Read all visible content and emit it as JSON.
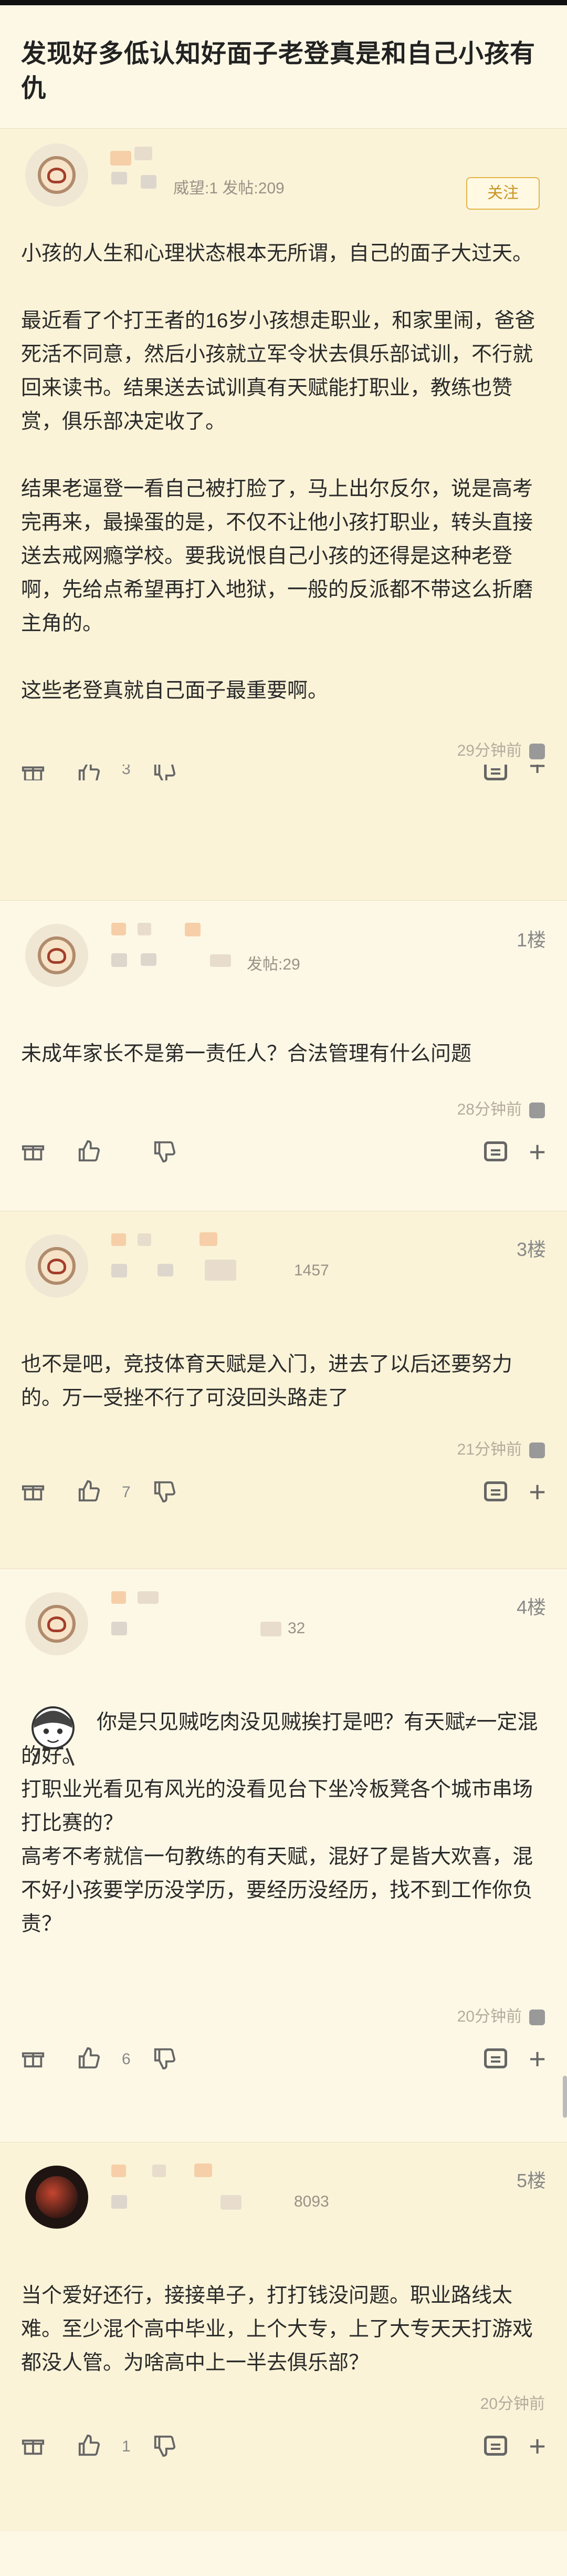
{
  "thread": {
    "title": "发现好多低认知好面子老登真是和自己小孩有仇"
  },
  "op": {
    "meta": "威望:1 发帖:209",
    "follow_label": "关注",
    "paragraphs": [
      "小孩的人生和心理状态根本无所谓，自己的面子大过天。",
      "最近看了个打王者的16岁小孩想走职业，和家里闹，爸爸死活不同意，然后小孩就立军令状去俱乐部试训，不行就回来读书。结果送去试训真有天赋能打职业，教练也赞赏，俱乐部决定收了。",
      "结果老逼登一看自己被打脸了，马上出尔反尔，说是高考完再来，最操蛋的是，不仅不让他小孩打职业，转头直接送去戒网瘾学校。要我说恨自己小孩的还得是这种老登啊，先给点希望再打入地狱，一般的反派都不带这么折磨主角的。",
      "这些老登真就自己面子最重要啊。"
    ],
    "time": "29分钟前",
    "like_count": "3"
  },
  "replies": [
    {
      "floor": "1楼",
      "meta": "发帖:29",
      "paragraphs": [
        "未成年家长不是第一责任人？合法管理有什么问题"
      ],
      "time": "28分钟前",
      "like_count": ""
    },
    {
      "floor": "3楼",
      "meta": "1457",
      "paragraphs": [
        "也不是吧，竞技体育天赋是入门，进去了以后还要努力的。万一受挫不行了可没回头路走了"
      ],
      "time": "21分钟前",
      "like_count": "7"
    },
    {
      "floor": "4楼",
      "meta": "32",
      "paragraphs": [
        "你是只见贼吃肉没见贼挨打是吧？有天赋≠一定混的好。",
        "打职业光看见有风光的没看见台下坐冷板凳各个城市串场打比赛的？",
        "高考不考就信一句教练的有天赋，混好了是皆大欢喜，混不好小孩要学历没学历，要经历没经历，找不到工作你负责？"
      ],
      "time": "20分钟前",
      "like_count": "6"
    },
    {
      "floor": "5楼",
      "meta": "8093",
      "paragraphs": [
        "当个爱好还行，接接单子，打打钱没问题。职业路线太难。至少混个高中毕业，上个大专，上了大专天天打游戏都没人管。为啥高中上一半去俱乐部？"
      ],
      "time": "20分钟前",
      "like_count": "1"
    }
  ],
  "colors": {
    "background": "#fdf8e6",
    "highlight_bg": "#faf3d8",
    "follow_accent": "#e4b44a",
    "muted_text": "#9a9186"
  }
}
